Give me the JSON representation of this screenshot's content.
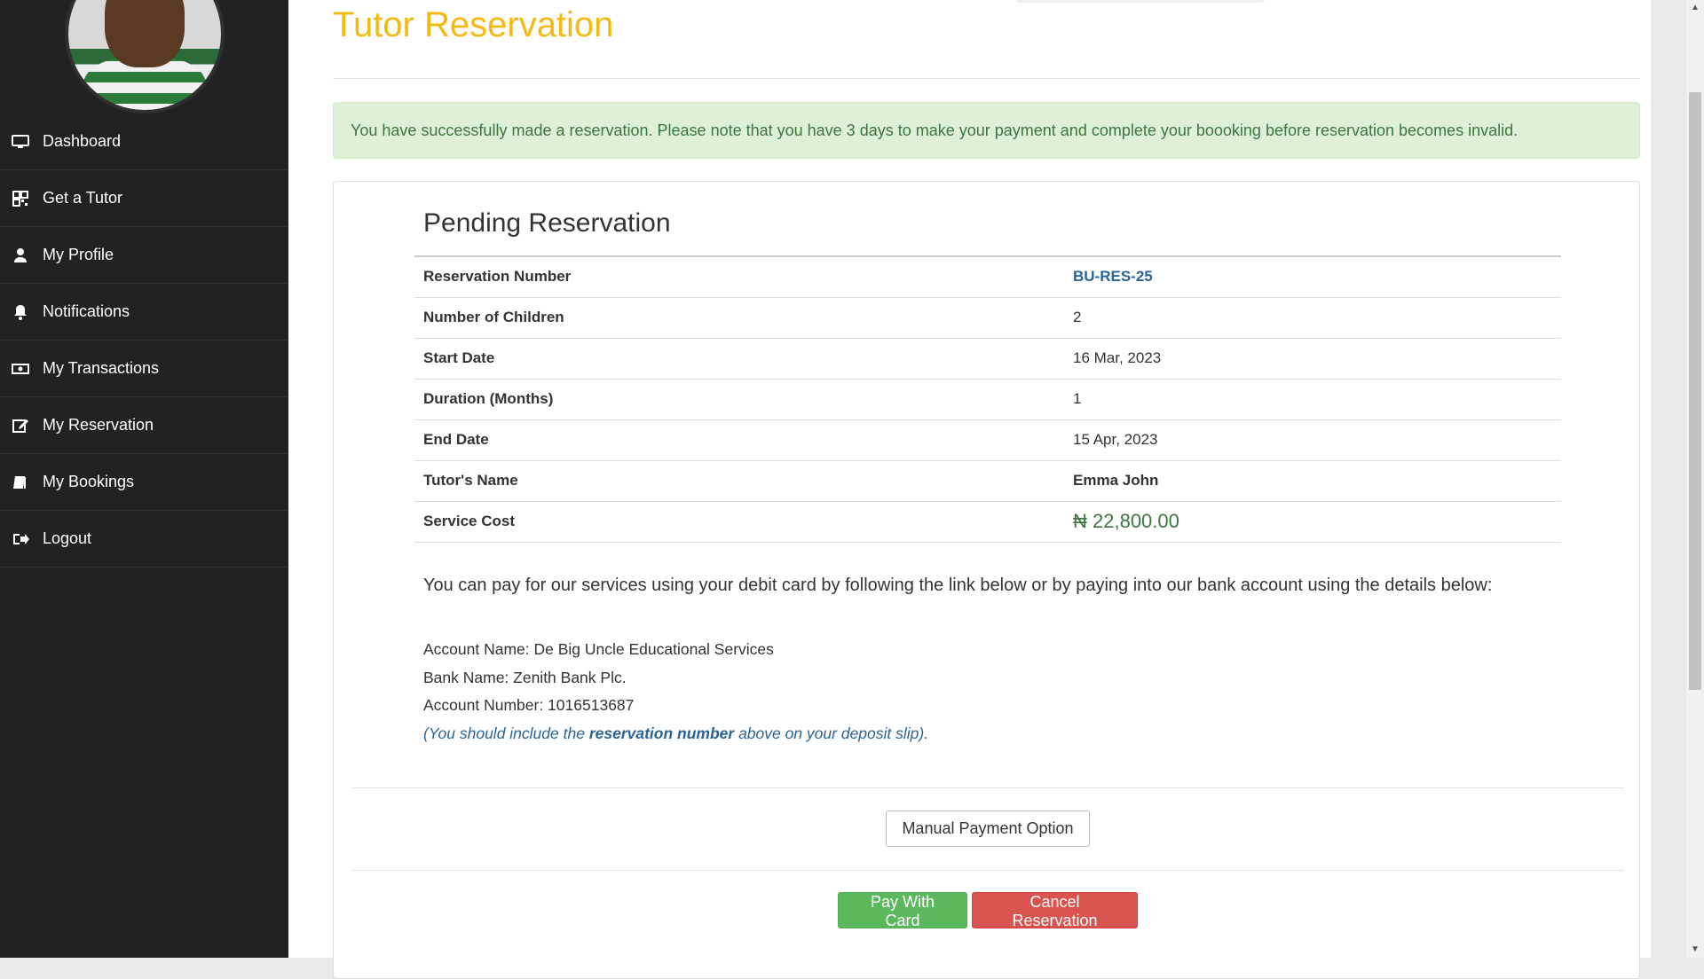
{
  "sidebar": {
    "items": [
      {
        "label": "Dashboard",
        "icon": "monitor-icon"
      },
      {
        "label": "Get a Tutor",
        "icon": "qrcode-icon"
      },
      {
        "label": "My Profile",
        "icon": "user-icon"
      },
      {
        "label": "Notifications",
        "icon": "bell-icon"
      },
      {
        "label": "My Transactions",
        "icon": "money-icon"
      },
      {
        "label": "My Reservation",
        "icon": "edit-icon"
      },
      {
        "label": "My Bookings",
        "icon": "book-icon"
      },
      {
        "label": "Logout",
        "icon": "logout-icon"
      }
    ]
  },
  "main": {
    "title": "Tutor Reservation",
    "alert": "You have successfully made a reservation. Please note that you have 3 days to make your payment and complete your boooking before reservation becomes invalid.",
    "panel": {
      "heading": "Pending Reservation",
      "rows": [
        {
          "label": "Reservation Number",
          "value": "BU-RES-25"
        },
        {
          "label": "Number of Children",
          "value": "2"
        },
        {
          "label": "Start Date",
          "value": "16 Mar, 2023"
        },
        {
          "label": "Duration (Months)",
          "value": "1"
        },
        {
          "label": "End Date",
          "value": "15 Apr, 2023"
        },
        {
          "label": "Tutor's Name",
          "value": "Emma John"
        },
        {
          "label": "Service Cost",
          "value": "₦ 22,800.00"
        }
      ],
      "payment_info": "You can pay for our services using your debit card by following the link below or by paying into our bank account using the details below:",
      "bank": {
        "account_name": "Account Name: De Big Uncle Educational Services",
        "bank_name": "Bank Name: Zenith Bank Plc.",
        "account_number": "Account Number: 1016513687",
        "note_prefix": "(You should include the ",
        "note_bold": "reservation number",
        "note_suffix": " above on your deposit slip)."
      },
      "buttons": {
        "manual": "Manual Payment Option",
        "pay_card": "Pay With Card",
        "cancel": "Cancel Reservation"
      }
    }
  },
  "colors": {
    "title": "#f5b914",
    "sidebar_bg": "#222222",
    "alert_bg": "#dff0d8",
    "alert_text": "#3c763d",
    "link": "#2a6496",
    "success": "#5cb85c",
    "danger": "#d9534f"
  }
}
